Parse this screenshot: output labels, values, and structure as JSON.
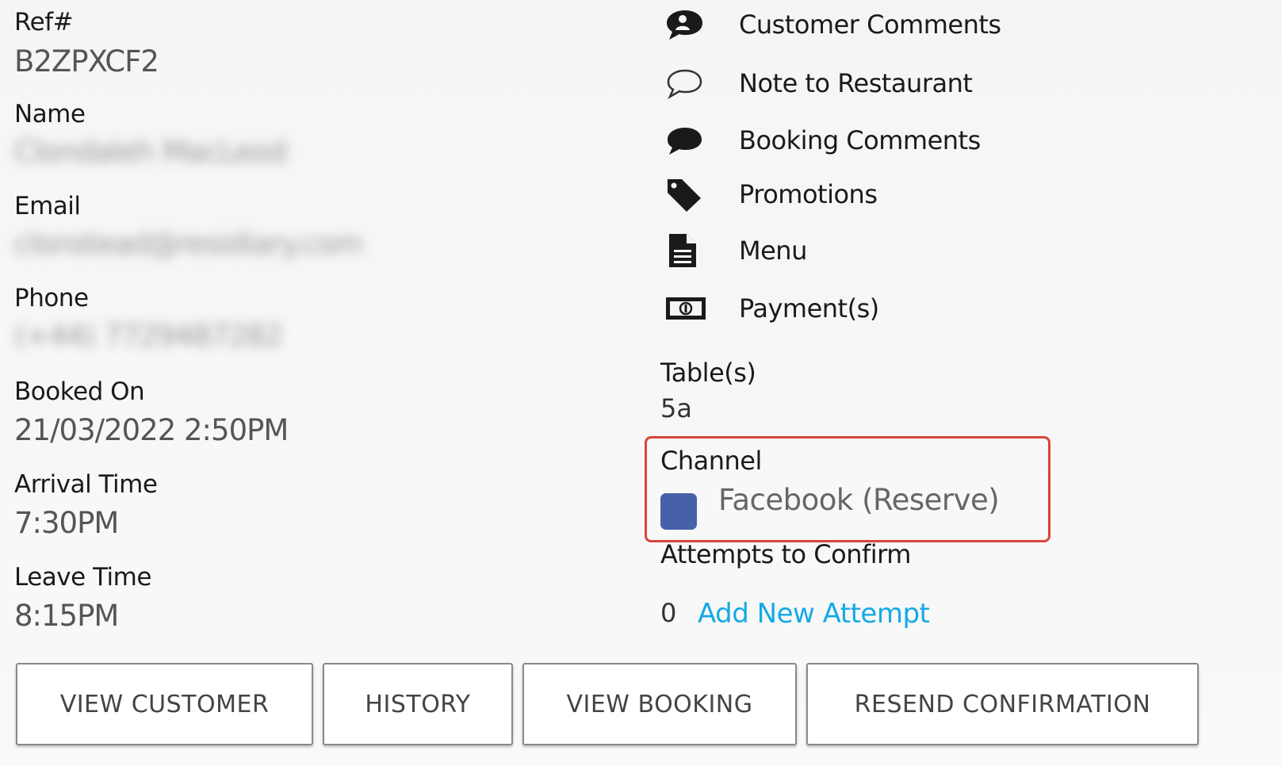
{
  "booking": {
    "ref": {
      "label": "Ref#",
      "value": "B2ZPXCF2"
    },
    "name": {
      "label": "Name",
      "value": "Clondaleh MacLeod"
    },
    "email": {
      "label": "Email",
      "value": "clonstead@residiary.com"
    },
    "phone": {
      "label": "Phone",
      "value": "(+44) 7729487282"
    },
    "booked_on": {
      "label": "Booked On",
      "value": "21/03/2022 2:50PM"
    },
    "arrival_time": {
      "label": "Arrival Time",
      "value": "7:30PM"
    },
    "leave_time": {
      "label": "Leave Time",
      "value": "8:15PM"
    }
  },
  "menu": {
    "items": [
      {
        "label": "Customer Comments",
        "icon": "customer-comments-icon"
      },
      {
        "label": "Note to Restaurant",
        "icon": "speech-bubble-outline-icon"
      },
      {
        "label": "Booking Comments",
        "icon": "speech-bubble-solid-icon"
      },
      {
        "label": "Promotions",
        "icon": "tag-icon"
      },
      {
        "label": "Menu",
        "icon": "document-icon"
      },
      {
        "label": "Payment(s)",
        "icon": "money-icon"
      }
    ]
  },
  "details": {
    "tables": {
      "label": "Table(s)",
      "value": "5a"
    },
    "channel": {
      "label": "Channel",
      "value": "Facebook (Reserve)",
      "color": "#4661a8"
    },
    "attempts": {
      "label": "Attempts to Confirm",
      "count": "0",
      "link": "Add New Attempt"
    }
  },
  "buttons": {
    "view_customer": "VIEW CUSTOMER",
    "history": "HISTORY",
    "view_booking": "VIEW BOOKING",
    "resend_confirmation": "RESEND CONFIRMATION"
  },
  "colors": {
    "link": "#14a9e6",
    "highlight_border": "#d9453b",
    "channel_swatch": "#4661a8"
  }
}
